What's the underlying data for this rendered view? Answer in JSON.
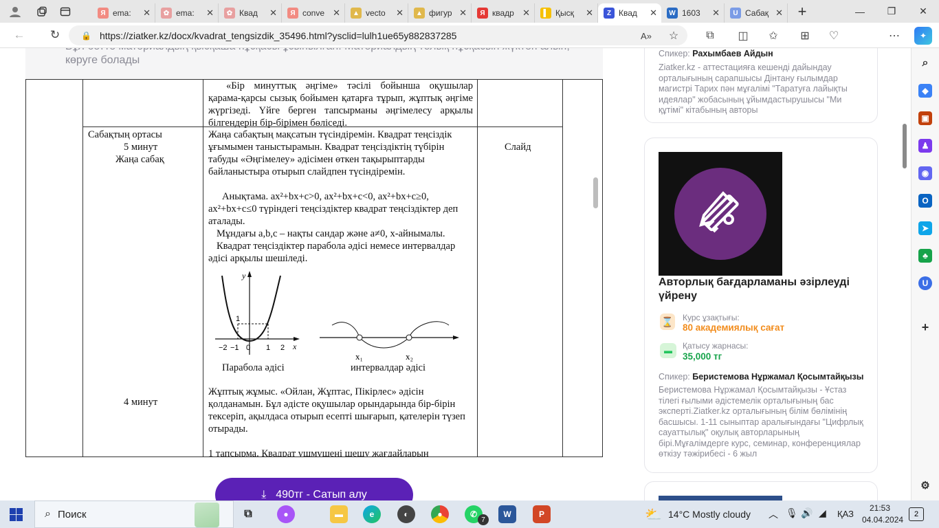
{
  "browser": {
    "tabs": [
      {
        "label": "ema:",
        "fav": "Я",
        "color": "#f28b82"
      },
      {
        "label": "ema:",
        "fav": "✿",
        "color": "#e8a0a0"
      },
      {
        "label": "Квад",
        "fav": "✿",
        "color": "#e8a0a0"
      },
      {
        "label": "conve",
        "fav": "Я",
        "color": "#f28b82"
      },
      {
        "label": "vecto",
        "fav": "▲",
        "color": "#e0b84c"
      },
      {
        "label": "фигур",
        "fav": "▲",
        "color": "#e0b84c"
      },
      {
        "label": "квадр",
        "fav": "Я",
        "color": "#e53935"
      },
      {
        "label": "Қысқ",
        "fav": "▌",
        "color": "#f6c000"
      },
      {
        "label": "Квад",
        "fav": "Z",
        "color": "#3b55d9",
        "active": true
      },
      {
        "label": "1603",
        "fav": "W",
        "color": "#2b6cc4"
      },
      {
        "label": "Сабақ",
        "fav": "U",
        "color": "#7b9ce6"
      }
    ],
    "url": "https://ziatker.kz/docx/kvadrat_tengsizdik_35496.html?ysclid=lulh1ue65y882837285"
  },
  "notice": {
    "text": "Бұл бетте материалдың қысқаша нұсқасы ұсынылған. Материалдың толық нұсқасын жүктеп алып, көруге болады"
  },
  "doc": {
    "top_row_text": "«Бір минуттық әңгіме» тәсілі бойынша оқушылар қарама-қарсы сызық бойымен қатарға тұрып, жұптық әңгіме жүргізеді. Үйге берген тапсырманы әңгімелесу арқылы білгендерін бір-бірімен бөліседі.",
    "stage_title": "Сабақтың ортасы",
    "stage_minutes": "5 минут",
    "stage_name": "Жаңа сабақ",
    "resource": "Слайд",
    "para1": "Жаңа сабақтың мақсатын түсіндіремін. Квадрат теңсіздік ұғымымен таныстырамын. Квадрат теңсіздіктің түбірін табуды «Әңгімелеу» әдісімен өткен тақырыптарды байланыстыра отырып слайдпен түсіндіремін.",
    "para2": "Анықтама. ax²+bx+c>0, ax²+bx+c<0, ax²+bx+c≥0, ax²+bx+c≤0 түріндегі теңсіздіктер квадрат теңсіздіктер деп аталады.",
    "para3": "Мұндағы a,b,c – нақты сандар және a≠0, x-айнымалы.",
    "para4": "Квадрат теңсіздіктер парабола әдісі немесе интервалдар әдісі арқылы шешіледі.",
    "graph": {
      "y": "y",
      "x": "x",
      "one": "1",
      "zero": "0",
      "m2": "−2",
      "m1": "−1",
      "p1": "1",
      "p2": "2"
    },
    "caption_left": "Парабола әдісі",
    "caption_right": "интервалдар әдісі",
    "x1": "x₁",
    "x2": "x₂",
    "minutes2": "4 минут",
    "para5": "Жұптық жұмыс. «Ойлан, Жұптас, Пікірлес» әдісін қолданамын. Бұл әдісте оқушылар орындарында бір-бірін тексеріп, ақылдаса отырып есепті шығарып, қателерін түзеп отырады.",
    "para6": "1 тапсырма. Квадрат үшмүшені шешу жағдайларын"
  },
  "buy_button": "490тг - Сатып алу",
  "right": {
    "card1": {
      "speaker_label": "Спикер:",
      "speaker": "Рахымбаев Айдын",
      "desc": "Ziatker.kz - аттестацияға кешенді дайындау орталығының сарапшысы Дінтану ғылымдар магистрі Тарих пән мұғалімі \"Таратуға лайықты идеялар\" жобасының ұйымдастырушысы \"Ми құтімі\" кітабының авторы"
    },
    "card2": {
      "title": "Авторлық бағдарламаны әзірлеуді үйрену",
      "duration_label": "Курс ұзақтығы:",
      "duration": "80 академиялық сағат",
      "fee_label": "Қатысу жарнасы:",
      "fee": "35,000 тг",
      "speaker_label": "Спикер:",
      "speaker": "Беристемова Нұржамал Қосымтайқызы",
      "desc": "Беристемова Нұржамал Қосымтайқызы - Ұстаз тілегі ғылыми әдістемелік орталығының бас эксперті.Ziatker.kz орталығының білім бөлімінің басшысы. 1-11 сыныптар аралығындағы \"Цифрлық сауаттылық\" оқулық авторларының бірі.Мұғалімдерге курс, семинар, конференциялар өткізу тәжірибесі - 6 жыл"
    }
  },
  "taskbar": {
    "search": "Поиск",
    "weather": "14°C Mostly cloudy",
    "lang": "ҚАЗ",
    "time": "21:53",
    "date": "04.04.2024",
    "badge": "7",
    "notif": "2"
  }
}
